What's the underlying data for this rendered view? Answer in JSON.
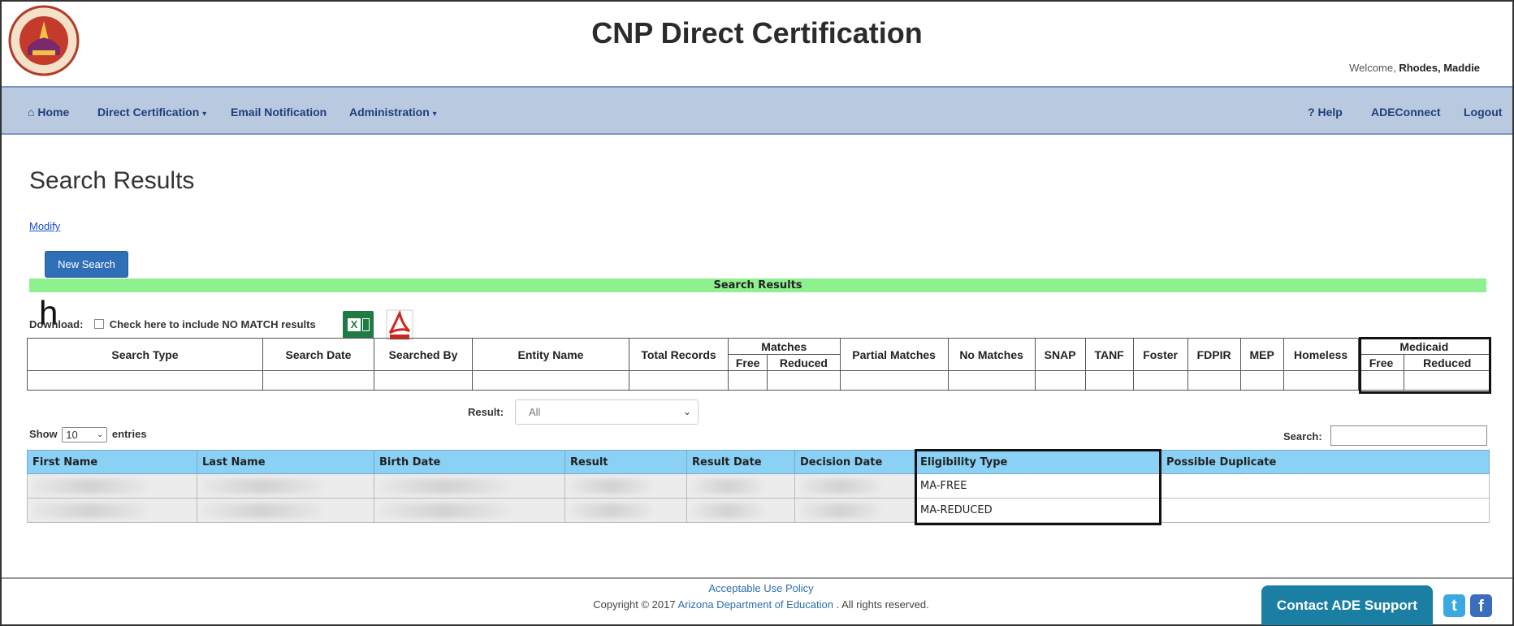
{
  "header": {
    "title": "CNP Direct Certification",
    "welcome_prefix": "Welcome,",
    "user_name": "Rhodes, Maddie"
  },
  "nav": {
    "home": "Home",
    "direct_certification": "Direct Certification",
    "email_notification": "Email Notification",
    "administration": "Administration",
    "help": "Help",
    "adeconnect": "ADEConnect",
    "logout": "Logout"
  },
  "page": {
    "title": "Search Results",
    "modify": "Modify",
    "new_search": "New Search",
    "results_band": "Search Results",
    "stray_char": "h",
    "download_label": "Download:",
    "include_no_match": "Check here to include NO MATCH results",
    "excel_glyph": "X"
  },
  "summary_table": {
    "search_type": "Search Type",
    "search_date": "Search Date",
    "searched_by": "Searched By",
    "entity_name": "Entity Name",
    "total_records": "Total Records",
    "matches": "Matches",
    "matches_free": "Free",
    "matches_reduced": "Reduced",
    "partial_matches": "Partial Matches",
    "no_matches": "No Matches",
    "snap": "SNAP",
    "tanf": "TANF",
    "foster": "Foster",
    "fdpir": "FDPIR",
    "mep": "MEP",
    "homeless": "Homeless",
    "medicaid": "Medicaid",
    "medicaid_free": "Free",
    "medicaid_reduced": "Reduced"
  },
  "filters": {
    "result_label": "Result:",
    "result_value": "All",
    "show": "Show",
    "entries_value": "10",
    "entries": "entries",
    "search_label": "Search:"
  },
  "data_table": {
    "columns": [
      "First Name",
      "Last Name",
      "Birth Date",
      "Result",
      "Result Date",
      "Decision Date",
      "Eligibility Type",
      "Possible Duplicate"
    ],
    "rows": [
      {
        "eligibility_type": "MA-FREE"
      },
      {
        "eligibility_type": "MA-REDUCED"
      }
    ]
  },
  "footer": {
    "acceptable_use": "Acceptable Use Policy",
    "copyright_prefix": "Copyright © 2017",
    "org_link": "Arizona Department of Education",
    "rights": ". All rights reserved.",
    "contact": "Contact ADE Support",
    "twitter_glyph": "t",
    "facebook_glyph": "f"
  },
  "colors": {
    "nav_bg": "#b9c9e0",
    "results_band": "#8ff08f",
    "table_header": "#8ad1f5",
    "button_blue": "#2f6fb7",
    "contact_btn": "#1a7fa3"
  }
}
